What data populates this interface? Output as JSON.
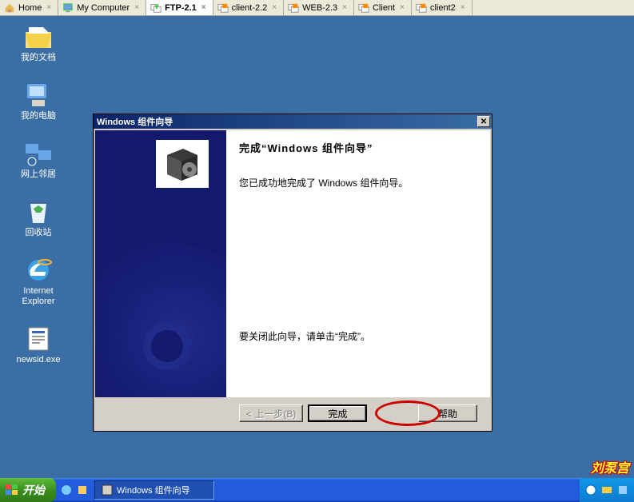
{
  "vmtabs": [
    {
      "label": "Home",
      "icon": "home",
      "active": false
    },
    {
      "label": "My Computer",
      "icon": "pc",
      "active": false
    },
    {
      "label": "FTP-2.1",
      "icon": "vm-on",
      "active": true
    },
    {
      "label": "client-2.2",
      "icon": "vm-off",
      "active": false
    },
    {
      "label": "WEB-2.3",
      "icon": "vm-off",
      "active": false
    },
    {
      "label": "Client",
      "icon": "vm-off",
      "active": false
    },
    {
      "label": "client2",
      "icon": "vm-off",
      "active": false
    }
  ],
  "desktop_icons": [
    {
      "label": "我的文档",
      "kind": "mydocs"
    },
    {
      "label": "我的电脑",
      "kind": "mycomputer"
    },
    {
      "label": "网上邻居",
      "kind": "network"
    },
    {
      "label": "回收站",
      "kind": "recycle"
    },
    {
      "label": "Internet\nExplorer",
      "kind": "ie"
    },
    {
      "label": "newsid.exe",
      "kind": "exe"
    }
  ],
  "dialog": {
    "title": "Windows 组件向导",
    "heading": "完成“Windows 组件向导”",
    "line1": "您已成功地完成了 Windows 组件向导。",
    "closeline": "要关闭此向导，请单击“完成”。",
    "back": "< 上一步(B)",
    "finish": "完成",
    "help": "帮助"
  },
  "taskbar": {
    "start": "开始",
    "task1": "Windows 组件向导"
  },
  "watermark": "刘泵宫"
}
